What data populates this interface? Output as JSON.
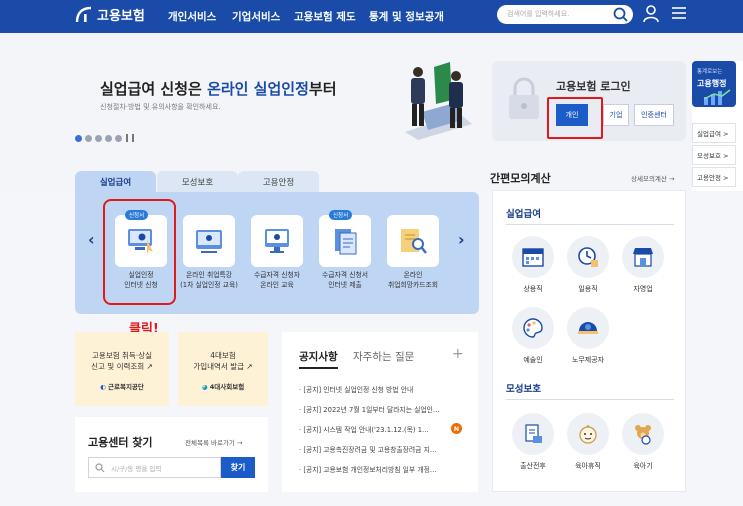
{
  "header": {
    "logo_text": "고용보험",
    "nav": [
      "개인서비스",
      "기업서비스",
      "고용보험 제도",
      "통계 및 정보공개"
    ],
    "search_placeholder": "검색어를 입력하세요."
  },
  "hero": {
    "title_highlight": "실업급여 신청",
    "title_mid": "은 ",
    "title_highlight2": "온라인 실업인정",
    "title_end": "부터",
    "subtitle": "신청절차·방법 및 유의사항을 확인하세요."
  },
  "login": {
    "title": "고용보험 로그인",
    "personal": "개인",
    "company": "기업",
    "cert": "인증센터"
  },
  "side_panel": {
    "top_small": "통계로보는",
    "top_big": "고용행정",
    "links": [
      "실업급여 >",
      "모성보호 >",
      "고용안정 >"
    ]
  },
  "tabs": [
    "실업급여",
    "모성보호",
    "고용안정"
  ],
  "services": [
    {
      "badge": "신청서",
      "line1": "실업인정",
      "line2": "인터넷 신청"
    },
    {
      "badge": "",
      "line1": "온라인 취업특강",
      "line2": "(1차 실업인정 교육)"
    },
    {
      "badge": "",
      "line1": "수급자격 신청자",
      "line2": "온라인 교육"
    },
    {
      "badge": "신청서",
      "line1": "수급자격 신청서",
      "line2": "인터넷 제출"
    },
    {
      "badge": "",
      "line1": "온라인",
      "line2": "취업희망카드조회"
    }
  ],
  "annotation": {
    "click": "클릭!"
  },
  "cards": [
    {
      "line1": "고용보험 취득·상실",
      "line2": "신고 및 이력조회",
      "org": "근로복지공단"
    },
    {
      "line1": "4대보험",
      "line2": "가입내역서 발급",
      "org": "4대사회보험"
    }
  ],
  "center": {
    "title": "고용센터 찾기",
    "all_link": "전체목록 바로가기 →",
    "placeholder": "시/구/동 명을 입력",
    "button": "찾기"
  },
  "notice": {
    "tab1": "공지사항",
    "tab2": "자주하는 질문",
    "plus": "+",
    "items": [
      "[공지] 인터넷 실업인정 신청 방법 안내",
      "[공지] 2022년 7월 1일부터 달라지는 실업인…",
      "[공지] 시스템 작업 안내('23.1.12.(목) 1…",
      "[공지] 고용촉진장려금 및 고용창출장려금 지…",
      "[공지] 고용보험 개인정보처리방침 일부 개정…"
    ],
    "new_badge": "N"
  },
  "calc": {
    "title": "간편모의계산",
    "detail": "상세모의계산 →",
    "sec1": "실업급여",
    "sec1_items": [
      "상용직",
      "일용직",
      "자영업",
      "예술인",
      "노무제공자"
    ],
    "sec2": "모성보호",
    "sec2_items": [
      "출산전후",
      "육아휴직",
      "육아기"
    ]
  },
  "colors": {
    "primary": "#1b4ba8",
    "accent": "#1b5cc8",
    "highlight": "#e01a1a"
  }
}
